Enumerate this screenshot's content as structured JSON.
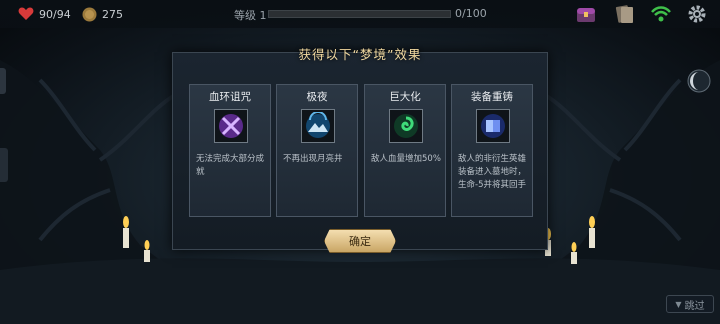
{
  "topbar": {
    "health": "90/94",
    "coins": "275",
    "level_label": "等级 1",
    "level_progress": "0/100",
    "level_fraction": 0
  },
  "dialog": {
    "title": "获得以下“梦境”效果",
    "confirm_label": "确定"
  },
  "cards": [
    {
      "title": "血环诅咒",
      "desc": "无法完成大部分成就",
      "icon": "purple-crossed-swords-icon",
      "color": "#8a3cc8"
    },
    {
      "title": "极夜",
      "desc": "不再出现月亮井",
      "icon": "night-mountain-icon",
      "color": "#2e8fd0"
    },
    {
      "title": "巨大化",
      "desc": "敌人血量增加50%",
      "icon": "green-spiral-icon",
      "color": "#2aa85a"
    },
    {
      "title": "装备重铸",
      "desc": "敌人的非衍生英雄装备进入墓地时，生命-5并将其回手",
      "icon": "blue-cards-icon",
      "color": "#4a6ad8"
    }
  ],
  "skip_label": "跳过",
  "colors": {
    "accent_gold": "#f1d9a0",
    "heart": "#d83a3a",
    "wifi": "#3fbf4a"
  }
}
